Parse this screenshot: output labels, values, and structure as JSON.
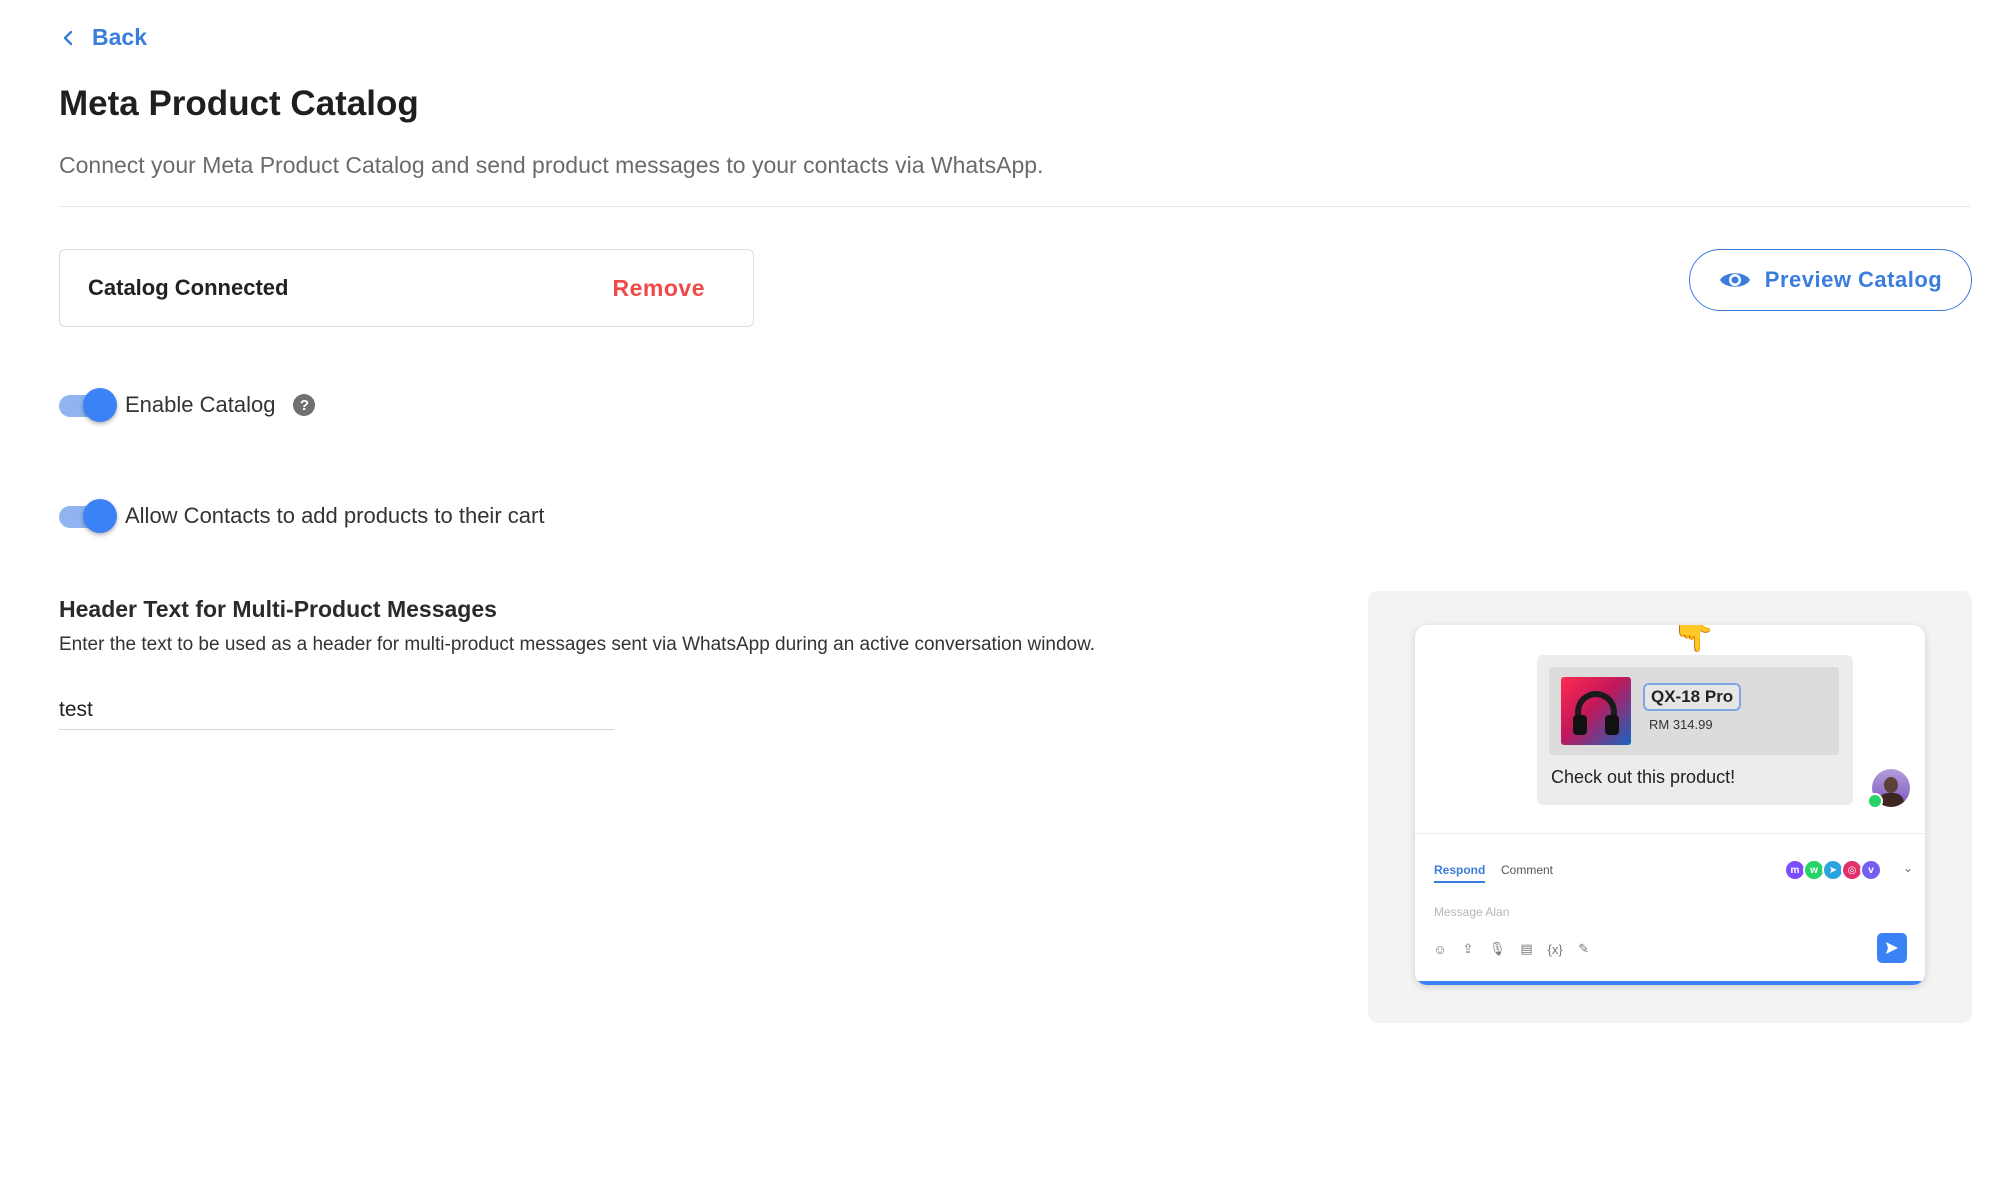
{
  "nav": {
    "back_label": "Back"
  },
  "page": {
    "title": "Meta Product Catalog",
    "description": "Connect your Meta Product Catalog and send product messages to your contacts via WhatsApp."
  },
  "catalog": {
    "status_label": "Catalog Connected",
    "remove_label": "Remove",
    "preview_label": "Preview Catalog"
  },
  "toggles": [
    {
      "label": "Enable Catalog",
      "enabled": true,
      "help_icon": "question-circle-icon"
    },
    {
      "label": "Allow Contacts to add products to their cart",
      "enabled": true
    }
  ],
  "header_text": {
    "title": "Header Text for Multi-Product Messages",
    "description": "Enter the text to be used as a header for multi-product messages sent via WhatsApp during an active conversation window.",
    "value": "test"
  },
  "preview": {
    "product_name": "QX-18 Pro",
    "product_price": "RM 314.99",
    "message": "Check out this product!",
    "pointer_glyph": "👇",
    "tabs": [
      "Respond",
      "Comment"
    ],
    "placeholder": "Message Alan",
    "channels": [
      {
        "name": "messenger-icon",
        "color": "#7b4dff"
      },
      {
        "name": "whatsapp-icon",
        "color": "#25d366"
      },
      {
        "name": "telegram-icon",
        "color": "#2aa3df"
      },
      {
        "name": "instagram-icon",
        "color": "#e1306c"
      },
      {
        "name": "viber-icon",
        "color": "#7360f2"
      }
    ],
    "tools": [
      "emoji-icon",
      "upload-icon",
      "microphone-icon",
      "note-icon",
      "variable-icon",
      "magic-wand-icon"
    ]
  },
  "colors": {
    "accent": "#3b7ddd",
    "danger": "#f0494a",
    "toggle_on": "#3b82f6"
  }
}
